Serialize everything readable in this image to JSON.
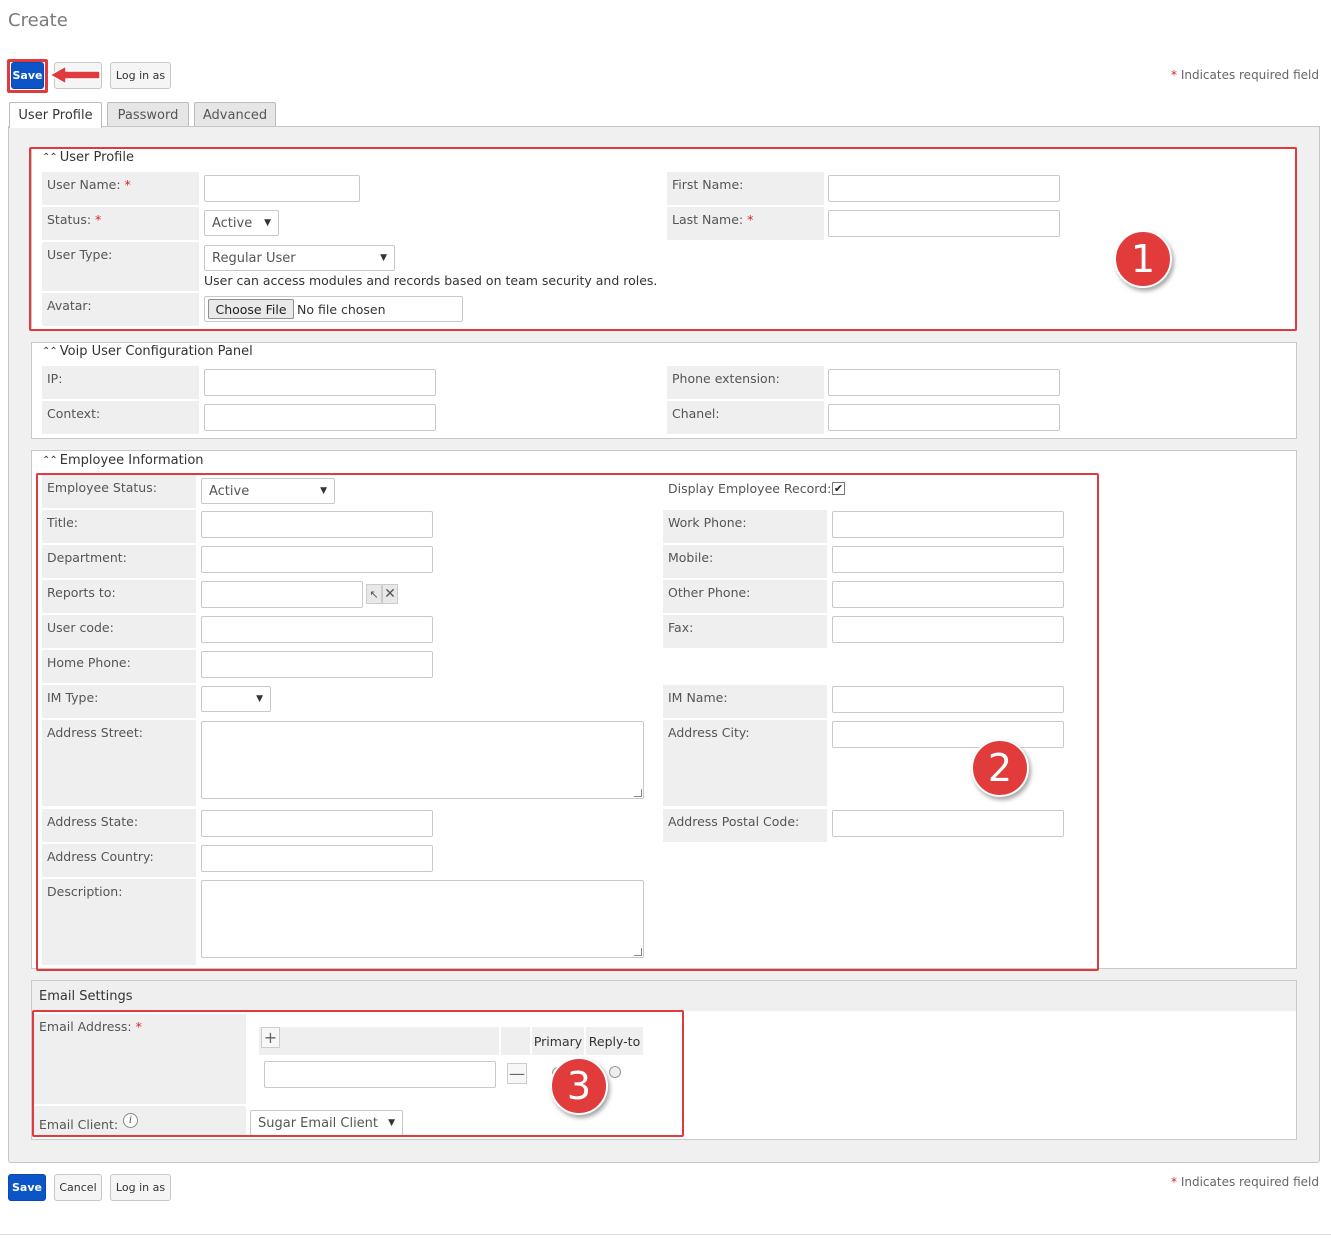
{
  "page": {
    "title": "Create"
  },
  "toolbar_top": {
    "save_label": "Save",
    "login_as_label": "Log in as"
  },
  "required_note": {
    "star": "*",
    "text": " Indicates required field"
  },
  "tabs": [
    {
      "label": "User Profile",
      "active": true
    },
    {
      "label": "Password",
      "active": false
    },
    {
      "label": "Advanced",
      "active": false
    }
  ],
  "user_profile": {
    "title": "User Profile",
    "user_name_label": "User Name:",
    "status_label": "Status:",
    "status_value": "Active",
    "user_type_label": "User Type:",
    "user_type_value": "Regular User",
    "user_type_help": "User can access modules and records based on team security and roles.",
    "avatar_label": "Avatar:",
    "choose_file_label": "Choose File",
    "no_file_text": "No file chosen",
    "first_name_label": "First Name:",
    "last_name_label": "Last Name:"
  },
  "voip": {
    "title": "Voip User Configuration Panel",
    "ip_label": "IP:",
    "context_label": "Context:",
    "phone_ext_label": "Phone extension:",
    "chanel_label": "Chanel:"
  },
  "employee": {
    "title": "Employee Information",
    "employee_status_label": "Employee Status:",
    "employee_status_value": "Active",
    "title_label": "Title:",
    "department_label": "Department:",
    "reports_to_label": "Reports to:",
    "user_code_label": "User code:",
    "home_phone_label": "Home Phone:",
    "im_type_label": "IM Type:",
    "address_street_label": "Address Street:",
    "address_state_label": "Address State:",
    "address_country_label": "Address Country:",
    "description_label": "Description:",
    "display_record_label": "Display Employee Record:",
    "display_record_checked": true,
    "work_phone_label": "Work Phone:",
    "mobile_label": "Mobile:",
    "other_phone_label": "Other Phone:",
    "fax_label": "Fax:",
    "im_name_label": "IM Name:",
    "address_city_label": "Address City:",
    "address_postal_label": "Address Postal Code:"
  },
  "email": {
    "title": "Email Settings",
    "address_label": "Email Address:",
    "primary_label": "Primary",
    "reply_to_label": "Reply-to",
    "client_label": "Email Client:",
    "client_value": "Sugar Email Client"
  },
  "toolbar_bottom": {
    "save_label": "Save",
    "cancel_label": "Cancel",
    "login_as_label": "Log in as"
  },
  "badges": {
    "one": "1",
    "two": "2",
    "three": "3"
  },
  "colors": {
    "accent": "#0b55c8",
    "annotation": "#e03a3e",
    "required": "#dd2222"
  }
}
